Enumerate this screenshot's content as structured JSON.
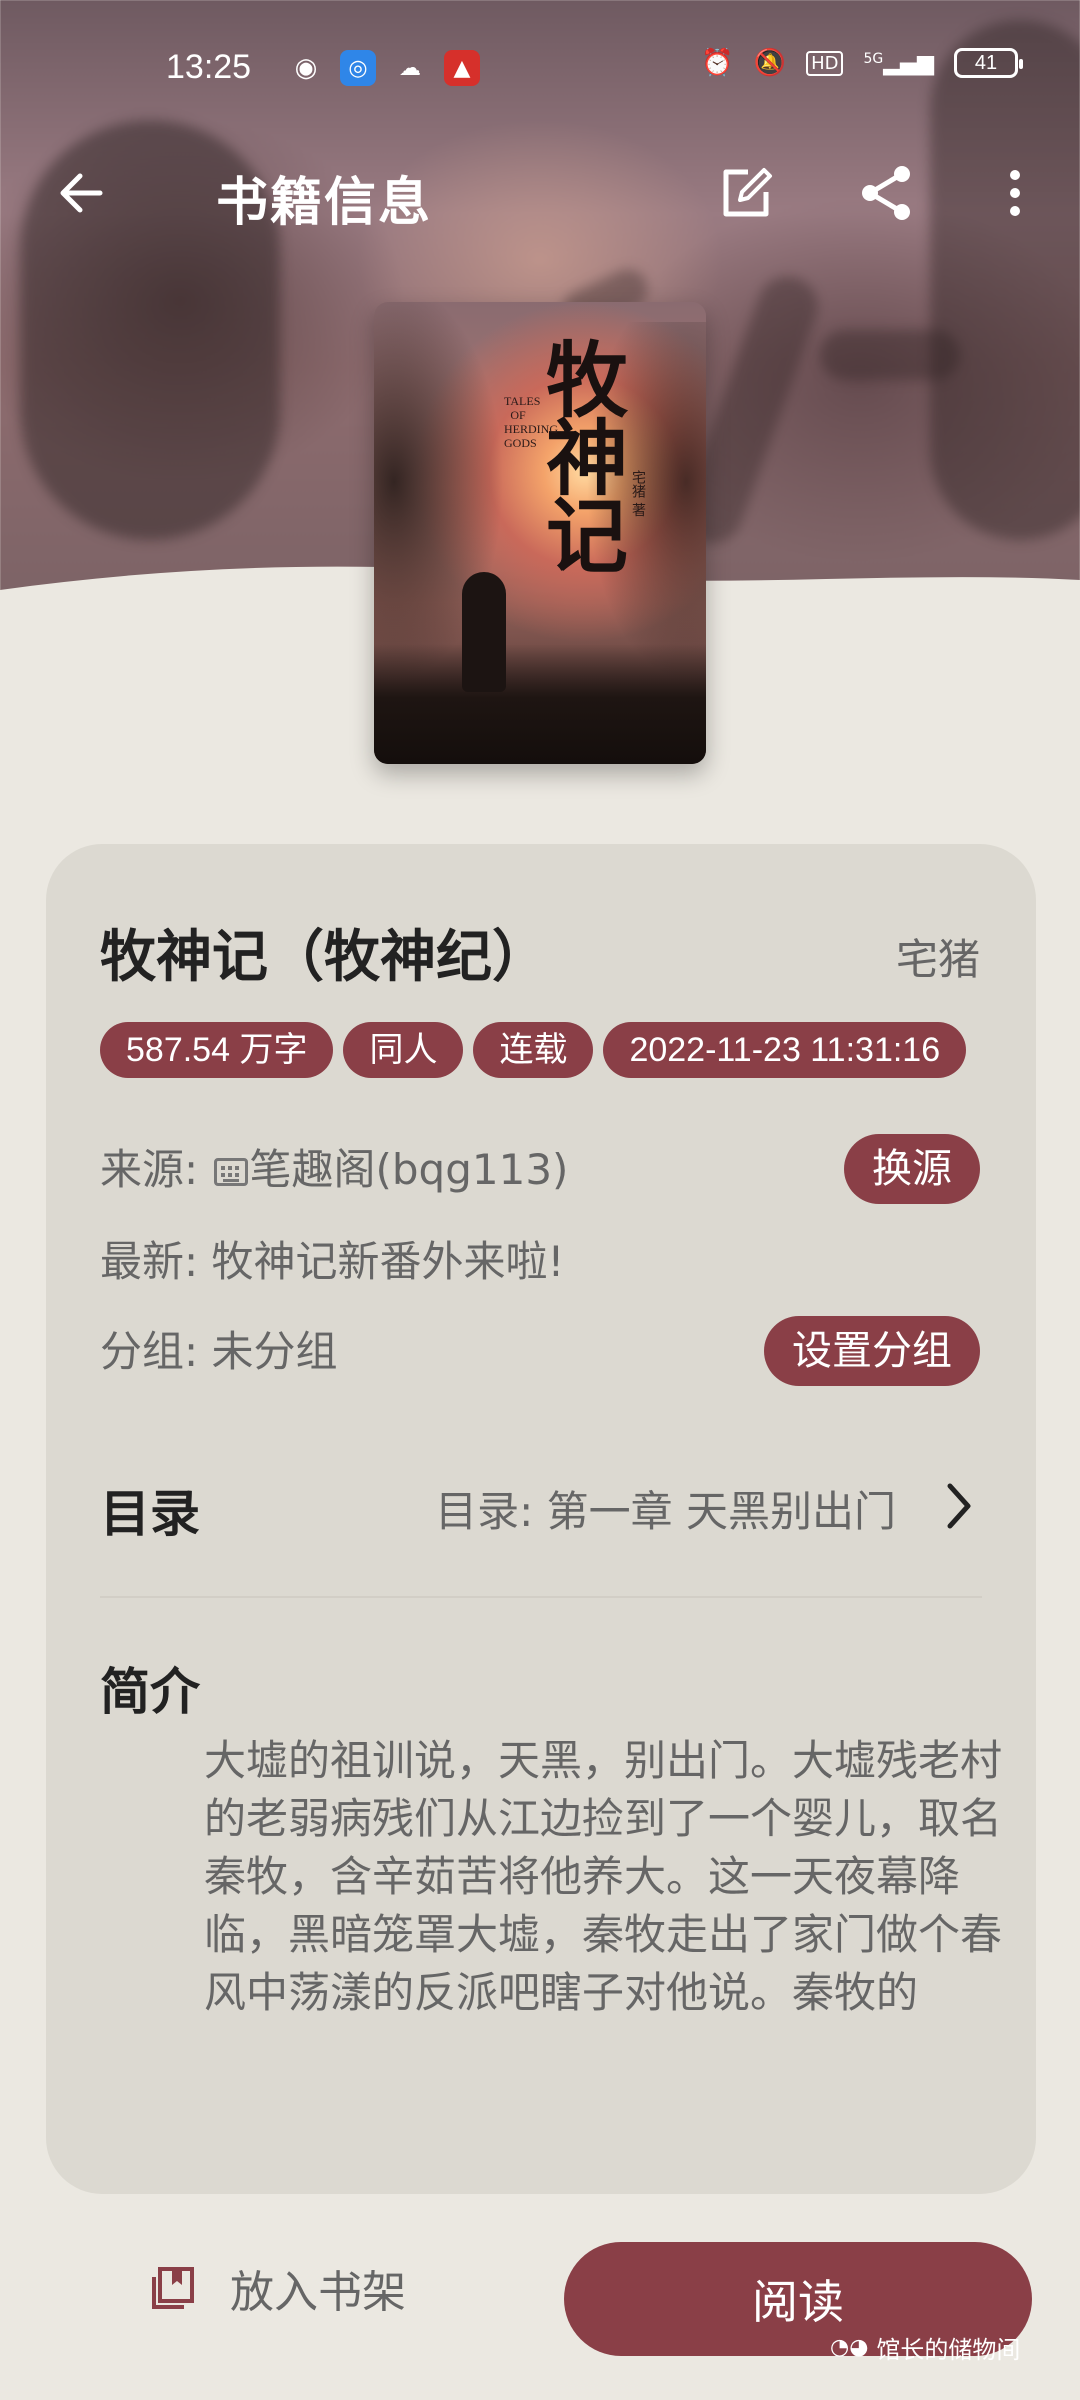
{
  "status_bar": {
    "time": "13:25",
    "network": "5G",
    "hd_label": "HD",
    "battery": "41",
    "icons": [
      "chat-bubble-icon",
      "circle-app-icon",
      "cloud-icon",
      "red-app-icon",
      "alarm-icon",
      "mute-icon",
      "hd-icon",
      "signal-icon",
      "battery-icon"
    ]
  },
  "app_bar": {
    "title": "书籍信息",
    "icons": [
      "back-arrow-icon",
      "edit-icon",
      "share-icon",
      "more-icon"
    ]
  },
  "cover": {
    "title": "牧神记",
    "subtitle": "TALES OF HERDING GODS",
    "author": "宅猪 著"
  },
  "book": {
    "title": "牧神记（牧神纪）",
    "author": "宅猪",
    "tags": [
      "587.54 万字",
      "同人",
      "连载",
      "2022-11-23 11:31:16"
    ],
    "source_label": "来源: ",
    "source_value": "笔趣阁(bqg113)",
    "change_source_btn": "换源",
    "latest": "最新: 牧神记新番外来啦!",
    "group": "分组: 未分组",
    "set_group_btn": "设置分组",
    "toc_label": "目录",
    "toc_value": "目录: 第一章 天黑别出门",
    "intro_label": "简介",
    "intro_text": "大墟的祖训说，天黑，别出门。大墟残老村的老弱病残们从江边捡到了一个婴儿，取名秦牧，含辛茹苦将他养大。这一天夜幕降临，黑暗笼罩大墟，秦牧走出了家门做个春风中荡漾的反派吧瞎子对他说。秦牧的"
  },
  "bottom": {
    "shelf_btn": "放入书架",
    "read_btn": "阅读"
  },
  "watermark": "馆长的储物间",
  "colors": {
    "accent": "#8a3f47",
    "card_bg": "#dcd9d1",
    "page_bg": "#ebe8e1"
  }
}
